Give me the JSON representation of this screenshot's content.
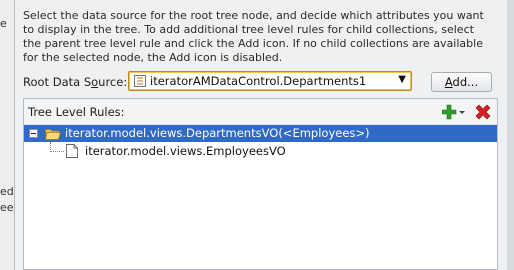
{
  "background": {
    "left_fragments": [
      "e",
      "ed",
      "ee"
    ]
  },
  "dialog": {
    "description": "Select the data source for the root tree node, and decide which attributes you want to display in the tree. To add additional tree level rules for child collections, select the parent tree level rule and click the Add icon. If no child collections are available for the selected node, the Add icon is disabled.",
    "root_source": {
      "label_prefix": "Root Data S",
      "label_mnemonic": "o",
      "label_suffix": "urce:",
      "value": "iteratorAMDataControl.Departments1"
    },
    "add_button": {
      "mnemonic": "A",
      "rest": "dd..."
    },
    "rules": {
      "title": "Tree Level Rules:",
      "items": [
        {
          "label": "iterator.model.views.DepartmentsVO(<Employees>)",
          "selected": true
        },
        {
          "label": "iterator.model.views.EmployeesVO",
          "selected": false
        }
      ]
    }
  },
  "colors": {
    "selection": "#316ac5",
    "focus_border": "#f2c452",
    "add_icon": "#2e9e2e",
    "delete_icon": "#d42020"
  }
}
